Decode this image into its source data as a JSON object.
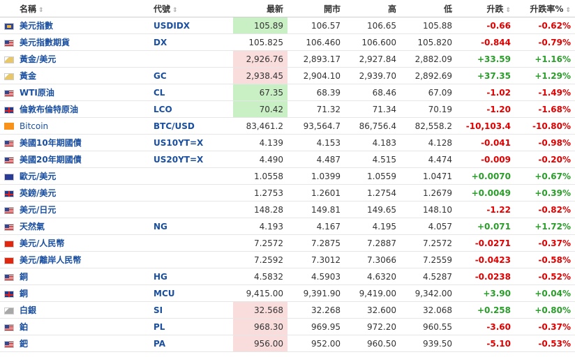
{
  "headers": {
    "name": "名稱",
    "code": "代號",
    "last": "最新",
    "open": "開市",
    "high": "高",
    "low": "低",
    "change": "升跌",
    "pct": "升跌率%"
  },
  "sort_icon": "⇕",
  "rows": [
    {
      "flag": "usd",
      "name": "美元指數",
      "code": "USDIDX",
      "last": "105.89",
      "open": "106.57",
      "high": "106.65",
      "low": "105.88",
      "change": "-0.66",
      "pct": "-0.62%",
      "dir": "down",
      "hl": "green"
    },
    {
      "flag": "us",
      "name": "美元指數期貨",
      "code": "DX",
      "last": "105.825",
      "open": "106.460",
      "high": "106.600",
      "low": "105.820",
      "change": "-0.844",
      "pct": "-0.79%",
      "dir": "down",
      "hl": ""
    },
    {
      "flag": "gold",
      "name": "黃金/美元",
      "code": "",
      "last": "2,926.76",
      "open": "2,893.17",
      "high": "2,927.84",
      "low": "2,882.09",
      "change": "+33.59",
      "pct": "+1.16%",
      "dir": "up",
      "hl": "red"
    },
    {
      "flag": "gold",
      "name": "黃金",
      "code": "GC",
      "last": "2,938.45",
      "open": "2,904.10",
      "high": "2,939.70",
      "low": "2,892.69",
      "change": "+37.35",
      "pct": "+1.29%",
      "dir": "up",
      "hl": "red"
    },
    {
      "flag": "us",
      "name": "WTI原油",
      "code": "CL",
      "last": "67.35",
      "open": "68.39",
      "high": "68.46",
      "low": "67.09",
      "change": "-1.02",
      "pct": "-1.49%",
      "dir": "down",
      "hl": "green"
    },
    {
      "flag": "uk",
      "name": "倫敦布倫特原油",
      "code": "LCO",
      "last": "70.42",
      "open": "71.32",
      "high": "71.34",
      "low": "70.19",
      "change": "-1.20",
      "pct": "-1.68%",
      "dir": "down",
      "hl": "green"
    },
    {
      "flag": "btc",
      "name": "Bitcoin",
      "code": "BTC/USD",
      "last": "83,461.2",
      "open": "93,564.7",
      "high": "86,756.4",
      "low": "82,558.2",
      "change": "-10,103.4",
      "pct": "-10.80%",
      "dir": "down",
      "hl": "",
      "plain": true
    },
    {
      "flag": "us",
      "name": "美國10年期國債",
      "code": "US10YT=X",
      "last": "4.139",
      "open": "4.153",
      "high": "4.183",
      "low": "4.128",
      "change": "-0.041",
      "pct": "-0.98%",
      "dir": "down",
      "hl": ""
    },
    {
      "flag": "us",
      "name": "美國20年期國債",
      "code": "US20YT=X",
      "last": "4.490",
      "open": "4.487",
      "high": "4.515",
      "low": "4.474",
      "change": "-0.009",
      "pct": "-0.20%",
      "dir": "down",
      "hl": ""
    },
    {
      "flag": "eu",
      "name": "歐元/美元",
      "code": "",
      "last": "1.0558",
      "open": "1.0399",
      "high": "1.0559",
      "low": "1.0471",
      "change": "+0.0070",
      "pct": "+0.67%",
      "dir": "up",
      "hl": ""
    },
    {
      "flag": "uk",
      "name": "英鎊/美元",
      "code": "",
      "last": "1.2753",
      "open": "1.2601",
      "high": "1.2754",
      "low": "1.2679",
      "change": "+0.0049",
      "pct": "+0.39%",
      "dir": "up",
      "hl": ""
    },
    {
      "flag": "us",
      "name": "美元/日元",
      "code": "",
      "last": "148.28",
      "open": "149.81",
      "high": "149.65",
      "low": "148.10",
      "change": "-1.22",
      "pct": "-0.82%",
      "dir": "down",
      "hl": ""
    },
    {
      "flag": "us",
      "name": "天然氣",
      "code": "NG",
      "last": "4.193",
      "open": "4.167",
      "high": "4.195",
      "low": "4.057",
      "change": "+0.071",
      "pct": "+1.72%",
      "dir": "up",
      "hl": ""
    },
    {
      "flag": "cn",
      "name": "美元/人民幣",
      "code": "",
      "last": "7.2572",
      "open": "7.2875",
      "high": "7.2887",
      "low": "7.2572",
      "change": "-0.0271",
      "pct": "-0.37%",
      "dir": "down",
      "hl": ""
    },
    {
      "flag": "cn",
      "name": "美元/離岸人民幣",
      "code": "",
      "last": "7.2592",
      "open": "7.3012",
      "high": "7.3066",
      "low": "7.2559",
      "change": "-0.0423",
      "pct": "-0.58%",
      "dir": "down",
      "hl": ""
    },
    {
      "flag": "us",
      "name": "銅",
      "code": "HG",
      "last": "4.5832",
      "open": "4.5903",
      "high": "4.6320",
      "low": "4.5287",
      "change": "-0.0238",
      "pct": "-0.52%",
      "dir": "down",
      "hl": ""
    },
    {
      "flag": "uk",
      "name": "銅",
      "code": "MCU",
      "last": "9,415.00",
      "open": "9,391.90",
      "high": "9,419.00",
      "low": "9,342.00",
      "change": "+3.90",
      "pct": "+0.04%",
      "dir": "up",
      "hl": ""
    },
    {
      "flag": "silver",
      "name": "白銀",
      "code": "SI",
      "last": "32.568",
      "open": "32.268",
      "high": "32.600",
      "low": "32.068",
      "change": "+0.258",
      "pct": "+0.80%",
      "dir": "up",
      "hl": "red"
    },
    {
      "flag": "us",
      "name": "鉑",
      "code": "PL",
      "last": "968.30",
      "open": "969.95",
      "high": "972.20",
      "low": "960.55",
      "change": "-3.60",
      "pct": "-0.37%",
      "dir": "down",
      "hl": "red"
    },
    {
      "flag": "us",
      "name": "鈀",
      "code": "PA",
      "last": "956.00",
      "open": "952.00",
      "high": "960.50",
      "low": "939.50",
      "change": "-5.10",
      "pct": "-0.53%",
      "dir": "down",
      "hl": "red"
    }
  ]
}
